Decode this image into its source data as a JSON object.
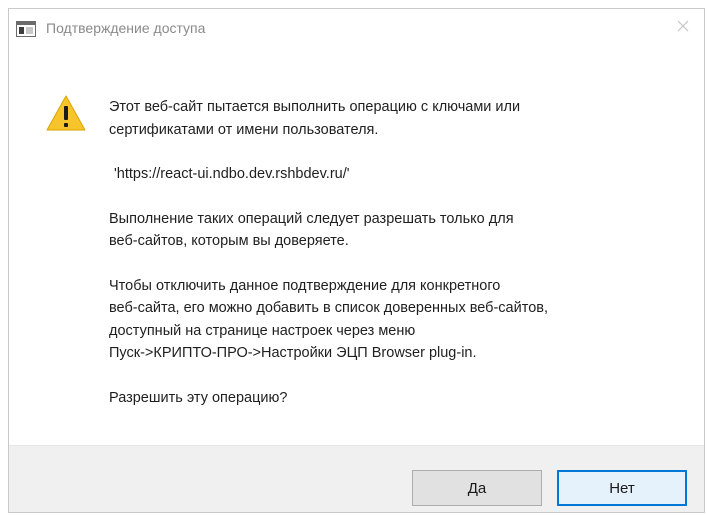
{
  "window": {
    "title": "Подтверждение доступа"
  },
  "icons": {
    "app": "window-app-icon",
    "close": "close-icon",
    "warning": "warning-triangle-icon"
  },
  "message": {
    "line1": "Этот веб-сайт пытается выполнить операцию с ключами или\nсертификатами от имени пользователя.",
    "url": "'https://react-ui.ndbo.dev.rshbdev.ru/'",
    "line2": "Выполнение таких операций следует разрешать только для\nвеб-сайтов, которым вы доверяете.",
    "line3": "Чтобы отключить данное подтверждение для конкретного\nвеб-сайта, его можно добавить в список доверенных веб-сайтов,\nдоступный на странице настроек через меню\nПуск->КРИПТО-ПРО->Настройки ЭЦП Browser plug-in.",
    "question": "Разрешить эту операцию?"
  },
  "buttons": {
    "yes": "Да",
    "no": "Нет"
  },
  "colors": {
    "warning_fill": "#f7c52b",
    "accent_border": "#0078d7",
    "footer_bg": "#f0f0f0"
  }
}
